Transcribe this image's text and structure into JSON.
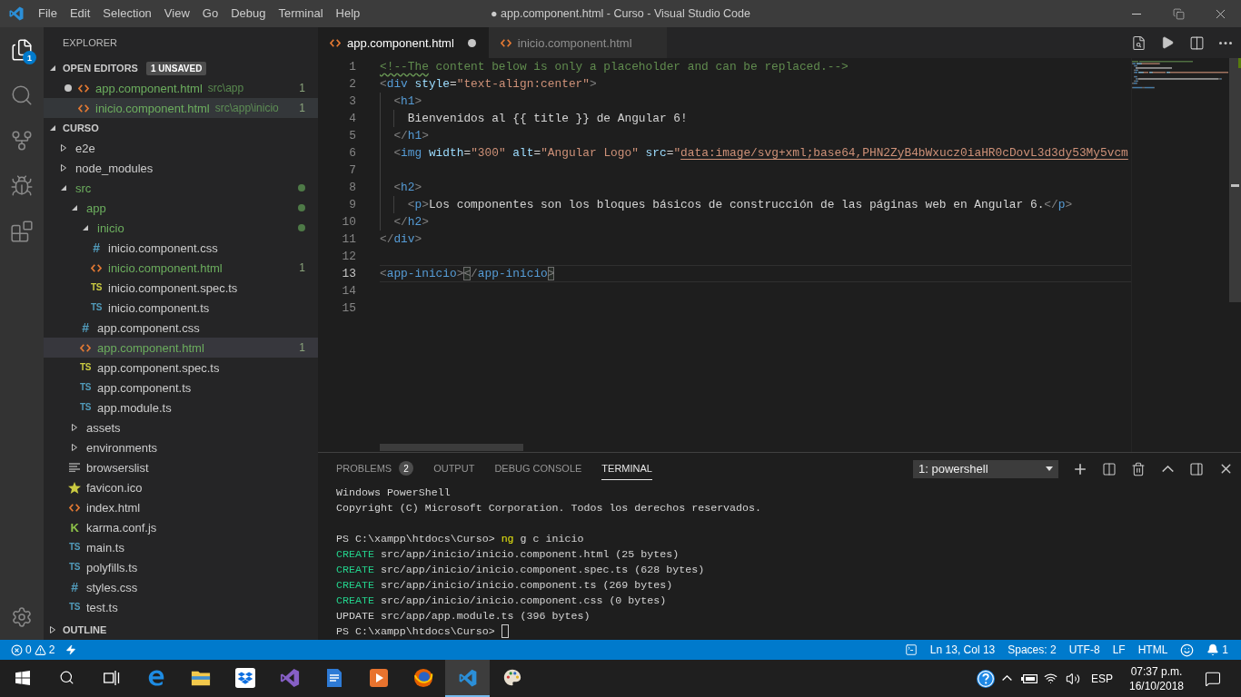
{
  "title_bar": {
    "menu": [
      "File",
      "Edit",
      "Selection",
      "View",
      "Go",
      "Debug",
      "Terminal",
      "Help"
    ],
    "title": "● app.component.html - Curso - Visual Studio Code"
  },
  "activity_bar": {
    "items": [
      {
        "selected": true,
        "badge": "1"
      },
      {
        "selected": false
      },
      {
        "selected": false
      },
      {
        "selected": false
      },
      {
        "selected": false
      }
    ]
  },
  "sidebar": {
    "title": "EXPLORER",
    "open_editors": {
      "label": "OPEN EDITORS",
      "badge": "1 UNSAVED",
      "expanded": true,
      "items": [
        {
          "name": "app.component.html",
          "path": "src\\app",
          "kind": "html",
          "problems": "1",
          "modified": true,
          "unsaved": true,
          "selected": false
        },
        {
          "name": "inicio.component.html",
          "path": "src\\app\\inicio",
          "kind": "html",
          "problems": "1",
          "modified": true,
          "unsaved": false,
          "selected": true
        }
      ]
    },
    "folder": {
      "label": "CURSO",
      "expanded": true,
      "tree": [
        {
          "name": "e2e",
          "kind": "folder",
          "expanded": false,
          "modified": false,
          "selected": false
        },
        {
          "name": "node_modules",
          "kind": "folder",
          "expanded": false,
          "modified": false,
          "selected": false
        },
        {
          "name": "src",
          "kind": "folder",
          "expanded": true,
          "modified": true,
          "selected": false,
          "children": [
            {
              "name": "app",
              "kind": "folder",
              "expanded": true,
              "modified": true,
              "selected": false,
              "children": [
                {
                  "name": "inicio",
                  "kind": "folder",
                  "expanded": true,
                  "modified": true,
                  "selected": false,
                  "children": [
                    {
                      "name": "inicio.component.css",
                      "kind": "css",
                      "glyph": "#",
                      "modified": false,
                      "selected": false
                    },
                    {
                      "name": "inicio.component.html",
                      "kind": "html",
                      "modified": true,
                      "selected": false,
                      "problems": "1"
                    },
                    {
                      "name": "inicio.component.spec.ts",
                      "kind": "spec",
                      "glyph": "TS",
                      "modified": false,
                      "selected": false
                    },
                    {
                      "name": "inicio.component.ts",
                      "kind": "ts",
                      "glyph": "TS",
                      "modified": false,
                      "selected": false
                    }
                  ]
                },
                {
                  "name": "app.component.css",
                  "kind": "css",
                  "glyph": "#",
                  "modified": false,
                  "selected": false
                },
                {
                  "name": "app.component.html",
                  "kind": "html",
                  "modified": true,
                  "selected": true,
                  "problems": "1"
                },
                {
                  "name": "app.component.spec.ts",
                  "kind": "spec",
                  "glyph": "TS",
                  "modified": false,
                  "selected": false
                },
                {
                  "name": "app.component.ts",
                  "kind": "ts",
                  "glyph": "TS",
                  "modified": false,
                  "selected": false
                },
                {
                  "name": "app.module.ts",
                  "kind": "ts",
                  "glyph": "TS",
                  "modified": false,
                  "selected": false
                }
              ]
            },
            {
              "name": "assets",
              "kind": "folder",
              "expanded": false,
              "modified": false,
              "selected": false
            },
            {
              "name": "environments",
              "kind": "folder",
              "expanded": false,
              "modified": false,
              "selected": false
            },
            {
              "name": "browserslist",
              "kind": "list",
              "modified": false,
              "selected": false
            },
            {
              "name": "favicon.ico",
              "kind": "image",
              "modified": false,
              "selected": false
            },
            {
              "name": "index.html",
              "kind": "html",
              "modified": false,
              "selected": false
            },
            {
              "name": "karma.conf.js",
              "kind": "karma",
              "glyph": "K",
              "modified": false,
              "selected": false
            },
            {
              "name": "main.ts",
              "kind": "ts",
              "glyph": "TS",
              "modified": false,
              "selected": false
            },
            {
              "name": "polyfills.ts",
              "kind": "ts",
              "glyph": "TS",
              "modified": false,
              "selected": false
            },
            {
              "name": "styles.css",
              "kind": "css",
              "glyph": "#",
              "modified": false,
              "selected": false
            },
            {
              "name": "test.ts",
              "kind": "ts",
              "glyph": "TS",
              "modified": false,
              "selected": false
            }
          ]
        }
      ]
    },
    "outline": {
      "label": "OUTLINE",
      "expanded": false
    }
  },
  "editor": {
    "tabs": [
      {
        "name": "app.component.html",
        "kind": "html",
        "selected": true,
        "unsaved": true
      },
      {
        "name": "inicio.component.html",
        "kind": "html",
        "selected": false,
        "unsaved": false
      }
    ],
    "lines": [
      {
        "number": "1",
        "current": false,
        "tokens": [
          {
            "kind": "squiggle",
            "text": "<!--The"
          },
          {
            "kind": "comment",
            "text": " content below is only a placeholder and can be replaced.-->"
          }
        ]
      },
      {
        "number": "2",
        "current": false,
        "tokens": [
          {
            "kind": "punct",
            "text": "<"
          },
          {
            "kind": "tag",
            "text": "div"
          },
          {
            "kind": "attr",
            "text": " style"
          },
          {
            "kind": "text",
            "text": "="
          },
          {
            "kind": "string",
            "text": "\"text-align:center\""
          },
          {
            "kind": "punct",
            "text": ">"
          }
        ]
      },
      {
        "number": "3",
        "current": false,
        "tokens": [
          {
            "kind": "punct",
            "text": "  <"
          },
          {
            "kind": "tag",
            "text": "h1"
          },
          {
            "kind": "punct",
            "text": ">"
          }
        ]
      },
      {
        "number": "4",
        "current": false,
        "tokens": [
          {
            "kind": "text",
            "text": "    Bienvenidos al {{ title }} de Angular 6!"
          }
        ]
      },
      {
        "number": "5",
        "current": false,
        "tokens": [
          {
            "kind": "punct",
            "text": "  </"
          },
          {
            "kind": "tag",
            "text": "h1"
          },
          {
            "kind": "punct",
            "text": ">"
          }
        ]
      },
      {
        "number": "6",
        "current": false,
        "tokens": [
          {
            "kind": "punct",
            "text": "  <"
          },
          {
            "kind": "tag",
            "text": "img"
          },
          {
            "kind": "attr",
            "text": " width"
          },
          {
            "kind": "text",
            "text": "="
          },
          {
            "kind": "string",
            "text": "\"300\""
          },
          {
            "kind": "attr",
            "text": " alt"
          },
          {
            "kind": "text",
            "text": "="
          },
          {
            "kind": "string",
            "text": "\"Angular Logo\""
          },
          {
            "kind": "attr",
            "text": " src"
          },
          {
            "kind": "text",
            "text": "="
          },
          {
            "kind": "string",
            "text": "\""
          },
          {
            "kind": "link",
            "text": "data:image/svg+xml;base64,PHN2ZyB4bWxucz0iaHR0cDovL3d3dy53My5vcm"
          }
        ]
      },
      {
        "number": "7",
        "current": false
      },
      {
        "number": "8",
        "current": false,
        "tokens": [
          {
            "kind": "punct",
            "text": "  <"
          },
          {
            "kind": "tag",
            "text": "h2"
          },
          {
            "kind": "punct",
            "text": ">"
          }
        ]
      },
      {
        "number": "9",
        "current": false,
        "tokens": [
          {
            "kind": "punct",
            "text": "    <"
          },
          {
            "kind": "tag",
            "text": "p"
          },
          {
            "kind": "punct",
            "text": ">"
          },
          {
            "kind": "text",
            "text": "Los componentes son los bloques básicos de construcción de las páginas web en Angular 6."
          },
          {
            "kind": "punct",
            "text": "</"
          },
          {
            "kind": "tag",
            "text": "p"
          },
          {
            "kind": "punct",
            "text": ">"
          }
        ]
      },
      {
        "number": "10",
        "current": false,
        "tokens": [
          {
            "kind": "punct",
            "text": "  </"
          },
          {
            "kind": "tag",
            "text": "h2"
          },
          {
            "kind": "punct",
            "text": ">"
          }
        ]
      },
      {
        "number": "11",
        "current": false,
        "tokens": [
          {
            "kind": "punct",
            "text": "</"
          },
          {
            "kind": "tag",
            "text": "div"
          },
          {
            "kind": "punct",
            "text": ">"
          }
        ]
      },
      {
        "number": "12",
        "current": false
      },
      {
        "number": "13",
        "current": true,
        "tokens": [
          {
            "kind": "punct",
            "text": "<"
          },
          {
            "kind": "tag",
            "text": "app-inicio"
          },
          {
            "kind": "punct",
            "text": ">"
          },
          {
            "kind": "bracket",
            "text": "<"
          },
          {
            "kind": "punct",
            "text": "/"
          },
          {
            "kind": "tag",
            "text": "app-inicio"
          },
          {
            "kind": "bracket",
            "text": ">"
          }
        ]
      },
      {
        "number": "14",
        "current": false
      },
      {
        "number": "15",
        "current": false
      }
    ]
  },
  "panel": {
    "tabs": [
      {
        "label": "PROBLEMS",
        "badge": "2",
        "selected": false
      },
      {
        "label": "OUTPUT",
        "selected": false
      },
      {
        "label": "DEBUG CONSOLE",
        "selected": false
      },
      {
        "label": "TERMINAL",
        "selected": true
      }
    ],
    "terminal_select": "1: powershell",
    "terminal": {
      "blocks": [
        {
          "lines": [
            [
              {
                "kind": "plain",
                "text": "Windows PowerShell"
              }
            ],
            [
              {
                "kind": "plain",
                "text": "Copyright (C) Microsoft Corporation. Todos los derechos reservados."
              }
            ]
          ]
        },
        {
          "lines": [
            [
              {
                "kind": "plain",
                "text": "PS C:\\xampp\\htdocs\\Curso> "
              },
              {
                "kind": "command",
                "text": "ng"
              },
              {
                "kind": "plain",
                "text": " g c inicio"
              }
            ],
            [
              {
                "kind": "success",
                "text": "CREATE"
              },
              {
                "kind": "plain",
                "text": " src/app/inicio/inicio.component.html (25 bytes)"
              }
            ],
            [
              {
                "kind": "success",
                "text": "CREATE"
              },
              {
                "kind": "plain",
                "text": " src/app/inicio/inicio.component.spec.ts (628 bytes)"
              }
            ],
            [
              {
                "kind": "success",
                "text": "CREATE"
              },
              {
                "kind": "plain",
                "text": " src/app/inicio/inicio.component.ts (269 bytes)"
              }
            ],
            [
              {
                "kind": "success",
                "text": "CREATE"
              },
              {
                "kind": "plain",
                "text": " src/app/inicio/inicio.component.css (0 bytes)"
              }
            ],
            [
              {
                "kind": "plain",
                "text": "UPDATE src/app/app.module.ts (396 bytes)"
              }
            ],
            [
              {
                "kind": "plain",
                "text": "PS C:\\xampp\\htdocs\\Curso> "
              }
            ]
          ]
        }
      ]
    }
  },
  "status_bar": {
    "errors": "0",
    "warnings": "2",
    "items": [
      "Ln 13, Col 13",
      "Spaces: 2",
      "UTF-8",
      "LF",
      "HTML"
    ],
    "notifications": "1"
  },
  "taskbar": {
    "apps": [
      {
        "selected": false
      },
      {
        "selected": false
      },
      {
        "selected": false
      },
      {
        "selected": false
      },
      {
        "selected": false
      },
      {
        "selected": false
      },
      {
        "selected": false
      },
      {
        "selected": true
      },
      {
        "selected": false
      }
    ],
    "language": "ESP",
    "time": "07:37 p.m.",
    "date": "16/10/2018"
  }
}
